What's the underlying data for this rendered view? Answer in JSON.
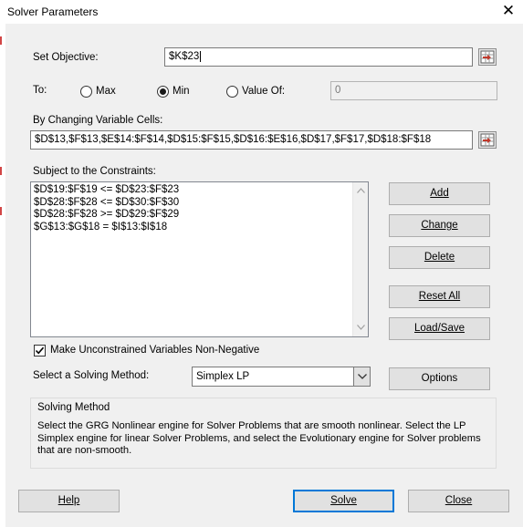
{
  "window": {
    "title": "Solver Parameters"
  },
  "objective": {
    "label": "Set Objective:",
    "value": "$K$23"
  },
  "to": {
    "label": "To:",
    "options": [
      {
        "label": "Max",
        "selected": false
      },
      {
        "label": "Min",
        "selected": true
      },
      {
        "label": "Value Of:",
        "selected": false
      }
    ],
    "value_of": "0"
  },
  "changing_cells": {
    "label": "By Changing Variable Cells:",
    "value": "$D$13,$F$13,$E$14:$F$14,$D$15:$F$15,$D$16:$E$16,$D$17,$F$17,$D$18:$F$18"
  },
  "constraints": {
    "label": "Subject to the Constraints:",
    "items": [
      "$D$19:$F$19 <= $D$23:$F$23",
      "$D$28:$F$28 <= $D$30:$F$30",
      "$D$28:$F$28 >= $D$29:$F$29",
      "$G$13:$G$18 = $I$13:$I$18"
    ]
  },
  "side_buttons": {
    "add": "Add",
    "change": "Change",
    "delete": "Delete",
    "reset_all": "Reset All",
    "load_save": "Load/Save",
    "options": "Options"
  },
  "nonneg": {
    "label": "Make Unconstrained Variables Non-Negative",
    "checked": true
  },
  "method": {
    "label": "Select a Solving Method:",
    "value": "Simplex LP"
  },
  "solving_method": {
    "title": "Solving Method",
    "text": "Select the GRG Nonlinear engine for Solver Problems that are smooth nonlinear. Select the LP Simplex engine for linear Solver Problems, and select the Evolutionary engine for Solver problems that are non-smooth."
  },
  "footer": {
    "help": "Help",
    "solve": "Solve",
    "close": "Close"
  },
  "icons": {
    "close": "close-icon",
    "range_ref": "range-reference-icon",
    "checkmark": "checkmark-icon",
    "dropdown": "chevron-down-icon",
    "scroll_up": "chevron-up-icon",
    "scroll_down": "chevron-down-icon"
  },
  "colors": {
    "default_button_border": "#0078d7",
    "dialog_bg": "#f0f0f0",
    "red_marker": "#d24545"
  }
}
